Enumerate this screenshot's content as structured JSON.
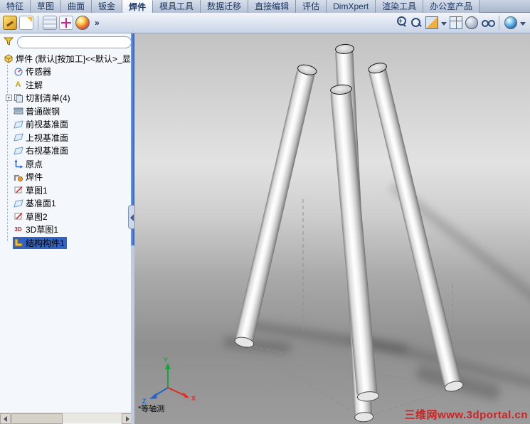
{
  "tabs": {
    "items": [
      {
        "label": "特征",
        "active": false
      },
      {
        "label": "草图",
        "active": false
      },
      {
        "label": "曲面",
        "active": false
      },
      {
        "label": "钣金",
        "active": false
      },
      {
        "label": "焊件",
        "active": true
      },
      {
        "label": "模具工具",
        "active": false
      },
      {
        "label": "数据迁移",
        "active": false
      },
      {
        "label": "直接编辑",
        "active": false
      },
      {
        "label": "评估",
        "active": false
      },
      {
        "label": "DimXpert",
        "active": false
      },
      {
        "label": "渲染工具",
        "active": false
      },
      {
        "label": "办公室产品",
        "active": false
      }
    ]
  },
  "toolbar": {
    "overflow_label": "»",
    "left_icons": [
      "weldment-tool-icon",
      "properties-icon",
      "sheet-grid-icon",
      "point-crosshair-icon",
      "render-sphere-icon"
    ],
    "right_icons": [
      "zoom-window-icon",
      "zoom-fit-icon",
      "section-view-icon",
      "view-orientation-icon",
      "display-style-icon",
      "hide-show-items-icon",
      "appearance-icon"
    ]
  },
  "feature_tree": {
    "filter": {
      "value": "",
      "placeholder": ""
    },
    "expand_glyph": "+",
    "root_label": "焊件 (默认[按加工]<<默认>_显",
    "items": [
      {
        "label": "传感器",
        "icon": "sensors-icon"
      },
      {
        "label": "注解",
        "icon": "annotations-icon"
      },
      {
        "label": "切割清单(4)",
        "icon": "cut-list-icon",
        "expandable": true
      },
      {
        "label": "普通碳钢",
        "icon": "material-icon"
      },
      {
        "label": "前视基准面",
        "icon": "plane-icon"
      },
      {
        "label": "上视基准面",
        "icon": "plane-icon"
      },
      {
        "label": "右视基准面",
        "icon": "plane-icon"
      },
      {
        "label": "原点",
        "icon": "origin-icon"
      },
      {
        "label": "焊件",
        "icon": "weldment-icon"
      },
      {
        "label": "草图1",
        "icon": "sketch-icon"
      },
      {
        "label": "基准面1",
        "icon": "plane-icon"
      },
      {
        "label": "草图2",
        "icon": "sketch-icon"
      },
      {
        "label": "3D草图1",
        "icon": "sketch3d-icon"
      },
      {
        "label": "结构构件1",
        "icon": "structural-member-icon",
        "selected": true
      }
    ]
  },
  "viewport": {
    "view_label": "*等轴测",
    "watermark": "三维网www.3dportal.cn",
    "triad": {
      "x_label": "X",
      "y_label": "Y",
      "z_label": "Z",
      "x_color": "#e02a20",
      "y_color": "#1da23a",
      "z_color": "#1e63d0"
    }
  },
  "colors": {
    "selection": "#2f63c4",
    "tab_text": "#1f3864",
    "watermark": "#cc2222"
  }
}
